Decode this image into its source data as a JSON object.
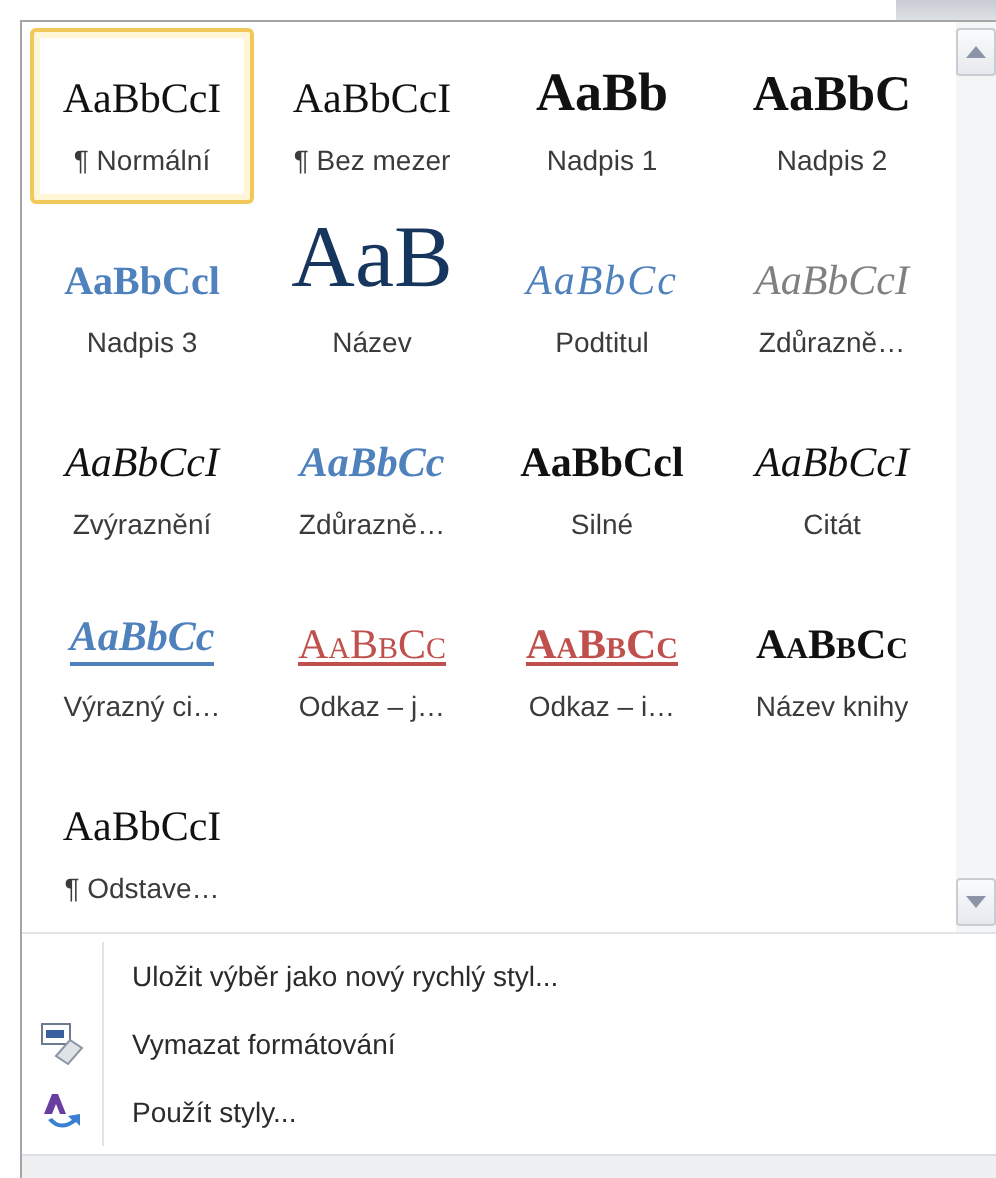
{
  "styles": [
    {
      "kind": "normal",
      "preview": "AaBbCcI",
      "label": "¶ Normální",
      "selected": true
    },
    {
      "kind": "normal",
      "preview": "AaBbCcI",
      "label": "¶ Bez mezer",
      "selected": false
    },
    {
      "kind": "heading1",
      "preview": "AaBb",
      "label": "Nadpis 1",
      "selected": false
    },
    {
      "kind": "heading2",
      "preview": "AaBbC",
      "label": "Nadpis 2",
      "selected": false
    },
    {
      "kind": "heading3",
      "preview": "AaBbCcl",
      "label": "Nadpis 3",
      "selected": false
    },
    {
      "kind": "title",
      "preview": "AaB",
      "label": "Název",
      "selected": false
    },
    {
      "kind": "subtitle",
      "preview": "AaBbCc",
      "label": "Podtitul",
      "selected": false
    },
    {
      "kind": "subtle-emphasis",
      "preview": "AaBbCcI",
      "label": "Zdůrazně…",
      "selected": false
    },
    {
      "kind": "emphasis",
      "preview": "AaBbCcI",
      "label": "Zvýraznění",
      "selected": false
    },
    {
      "kind": "intense-emphasis",
      "preview": "AaBbCc",
      "label": "Zdůrazně…",
      "selected": false
    },
    {
      "kind": "strong",
      "preview": "AaBbCcl",
      "label": "Silné",
      "selected": false
    },
    {
      "kind": "quote",
      "preview": "AaBbCcI",
      "label": "Citát",
      "selected": false
    },
    {
      "kind": "intense-quote",
      "preview": "AaBbCc",
      "label": "Výrazný ci…",
      "selected": false
    },
    {
      "kind": "subtle-reference",
      "preview": "AaBbCc",
      "label": "Odkaz – j…",
      "selected": false
    },
    {
      "kind": "intense-reference",
      "preview": "AaBbCc",
      "label": "Odkaz – i…",
      "selected": false
    },
    {
      "kind": "book-title",
      "preview": "AaBbCc",
      "label": "Název knihy",
      "selected": false
    },
    {
      "kind": "normal",
      "preview": "AaBbCcI",
      "label": "¶ Odstave…",
      "selected": false
    }
  ],
  "menu": [
    {
      "kind": "none",
      "label": "Uložit výběr jako nový rychlý styl..."
    },
    {
      "kind": "clear",
      "label": "Vymazat formátování"
    },
    {
      "kind": "apply",
      "label": "Použít styly..."
    }
  ]
}
